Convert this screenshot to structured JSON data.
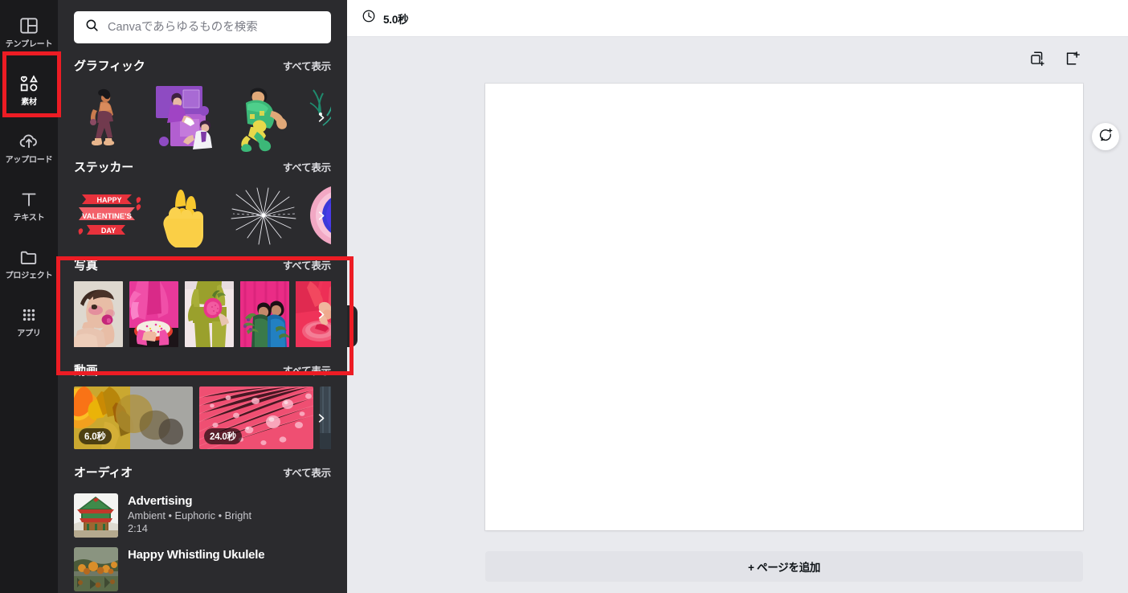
{
  "rail": {
    "items": [
      {
        "label": "テンプレート",
        "icon": "template-icon",
        "active": false
      },
      {
        "label": "素材",
        "icon": "elements-icon",
        "active": true
      },
      {
        "label": "アップロード",
        "icon": "upload-icon",
        "active": false
      },
      {
        "label": "テキスト",
        "icon": "text-icon",
        "active": false
      },
      {
        "label": "プロジェクト",
        "icon": "projects-icon",
        "active": false
      },
      {
        "label": "アプリ",
        "icon": "apps-icon",
        "active": false
      }
    ]
  },
  "search": {
    "placeholder": "Canvaであらゆるものを検索",
    "value": "",
    "icon": "search-icon"
  },
  "panel": {
    "see_all_label": "すべて表示",
    "sections": [
      {
        "key": "graphics",
        "title": "グラフィック"
      },
      {
        "key": "stickers",
        "title": "ステッカー"
      },
      {
        "key": "photos",
        "title": "写真"
      },
      {
        "key": "videos",
        "title": "動画"
      },
      {
        "key": "audio",
        "title": "オーディオ"
      }
    ],
    "videos": [
      {
        "duration": "6.0秒"
      },
      {
        "duration": "24.0秒"
      }
    ],
    "audio": [
      {
        "title": "Advertising",
        "tags": "Ambient • Euphoric • Bright",
        "duration": "2:14"
      },
      {
        "title": "Happy Whistling Ukulele",
        "tags": "",
        "duration": ""
      }
    ]
  },
  "editor": {
    "duration": "5.0秒",
    "clock_icon": "clock-icon",
    "duplicate_icon": "duplicate-page-icon",
    "add_page_icon": "add-page-icon",
    "comment_icon": "add-comment-icon",
    "add_page_label": "+ ページを追加"
  },
  "colors": {
    "rail_bg": "#1a1a1c",
    "panel_bg": "#2b2b2e",
    "editor_bg": "#e9eaee",
    "highlight": "#ed1c24",
    "page_white": "#ffffff"
  }
}
